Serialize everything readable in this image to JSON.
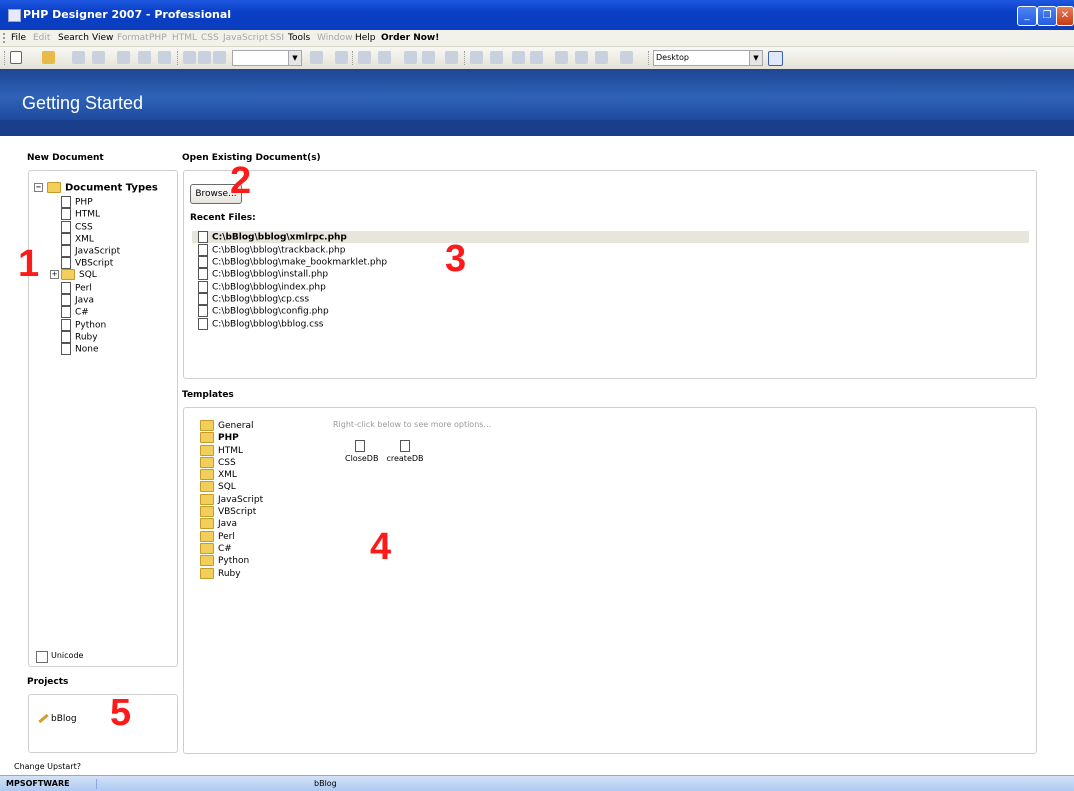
{
  "window": {
    "title": "PHP Designer 2007 - Professional",
    "minimize": "_",
    "restore": "❐",
    "close": "✕"
  },
  "menu": {
    "items": [
      {
        "label": "File",
        "enabled": true
      },
      {
        "label": "Edit",
        "enabled": false
      },
      {
        "label": "Search",
        "enabled": true
      },
      {
        "label": "View",
        "enabled": true
      },
      {
        "label": "Format",
        "enabled": false
      },
      {
        "label": "PHP",
        "enabled": false
      },
      {
        "label": "HTML",
        "enabled": false
      },
      {
        "label": "CSS",
        "enabled": false
      },
      {
        "label": "JavaScript",
        "enabled": false
      },
      {
        "label": "SSI",
        "enabled": false
      },
      {
        "label": "Tools",
        "enabled": true
      },
      {
        "label": "Window",
        "enabled": false
      },
      {
        "label": "Help",
        "enabled": true
      }
    ],
    "order_now": "Order Now!"
  },
  "toolbar": {
    "workspace_value": "Desktop",
    "arrow": "▼"
  },
  "banner": {
    "title": "Getting Started"
  },
  "new_document": {
    "heading": "New Document",
    "root_label": "Document Types",
    "expand_minus": "−",
    "expand_plus": "+",
    "types": [
      "PHP",
      "HTML",
      "CSS",
      "XML",
      "JavaScript",
      "VBScript",
      "SQL",
      "Perl",
      "Java",
      "C#",
      "Python",
      "Ruby",
      "None"
    ],
    "unicode_label": "Unicode"
  },
  "open_existing": {
    "heading": "Open Existing Document(s)",
    "browse_label": "Browse...",
    "recent_heading": "Recent Files:",
    "recent_files": [
      "C:\\bBlog\\bblog\\xmlrpc.php",
      "C:\\bBlog\\bblog\\trackback.php",
      "C:\\bBlog\\bblog\\make_bookmarklet.php",
      "C:\\bBlog\\bblog\\install.php",
      "C:\\bBlog\\bblog\\index.php",
      "C:\\bBlog\\bblog\\cp.css",
      "C:\\bBlog\\bblog\\config.php",
      "C:\\bBlog\\bblog\\bblog.css"
    ]
  },
  "templates": {
    "heading": "Templates",
    "hint": "Right-click below to see more options...",
    "folders": [
      "General",
      "PHP",
      "HTML",
      "CSS",
      "XML",
      "SQL",
      "JavaScript",
      "VBScript",
      "Java",
      "Perl",
      "C#",
      "Python",
      "Ruby"
    ],
    "selected_folder": "PHP",
    "files": [
      "CloseDB",
      "createDB"
    ]
  },
  "projects": {
    "heading": "Projects",
    "items": [
      "bBlog"
    ]
  },
  "change_upstart": "Change Upstart?",
  "statusbar": {
    "left": "MPSOFTWARE",
    "project": "bBlog"
  },
  "markers": [
    "1",
    "2",
    "3",
    "4",
    "5"
  ]
}
